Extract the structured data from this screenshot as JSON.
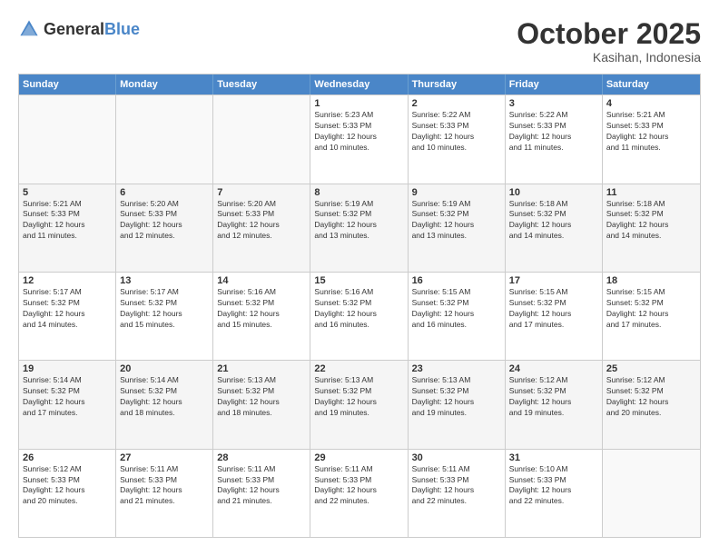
{
  "header": {
    "logo_general": "General",
    "logo_blue": "Blue",
    "month": "October 2025",
    "location": "Kasihan, Indonesia"
  },
  "days_of_week": [
    "Sunday",
    "Monday",
    "Tuesday",
    "Wednesday",
    "Thursday",
    "Friday",
    "Saturday"
  ],
  "weeks": [
    [
      {
        "num": "",
        "info": ""
      },
      {
        "num": "",
        "info": ""
      },
      {
        "num": "",
        "info": ""
      },
      {
        "num": "1",
        "info": "Sunrise: 5:23 AM\nSunset: 5:33 PM\nDaylight: 12 hours\nand 10 minutes."
      },
      {
        "num": "2",
        "info": "Sunrise: 5:22 AM\nSunset: 5:33 PM\nDaylight: 12 hours\nand 10 minutes."
      },
      {
        "num": "3",
        "info": "Sunrise: 5:22 AM\nSunset: 5:33 PM\nDaylight: 12 hours\nand 11 minutes."
      },
      {
        "num": "4",
        "info": "Sunrise: 5:21 AM\nSunset: 5:33 PM\nDaylight: 12 hours\nand 11 minutes."
      }
    ],
    [
      {
        "num": "5",
        "info": "Sunrise: 5:21 AM\nSunset: 5:33 PM\nDaylight: 12 hours\nand 11 minutes."
      },
      {
        "num": "6",
        "info": "Sunrise: 5:20 AM\nSunset: 5:33 PM\nDaylight: 12 hours\nand 12 minutes."
      },
      {
        "num": "7",
        "info": "Sunrise: 5:20 AM\nSunset: 5:33 PM\nDaylight: 12 hours\nand 12 minutes."
      },
      {
        "num": "8",
        "info": "Sunrise: 5:19 AM\nSunset: 5:32 PM\nDaylight: 12 hours\nand 13 minutes."
      },
      {
        "num": "9",
        "info": "Sunrise: 5:19 AM\nSunset: 5:32 PM\nDaylight: 12 hours\nand 13 minutes."
      },
      {
        "num": "10",
        "info": "Sunrise: 5:18 AM\nSunset: 5:32 PM\nDaylight: 12 hours\nand 14 minutes."
      },
      {
        "num": "11",
        "info": "Sunrise: 5:18 AM\nSunset: 5:32 PM\nDaylight: 12 hours\nand 14 minutes."
      }
    ],
    [
      {
        "num": "12",
        "info": "Sunrise: 5:17 AM\nSunset: 5:32 PM\nDaylight: 12 hours\nand 14 minutes."
      },
      {
        "num": "13",
        "info": "Sunrise: 5:17 AM\nSunset: 5:32 PM\nDaylight: 12 hours\nand 15 minutes."
      },
      {
        "num": "14",
        "info": "Sunrise: 5:16 AM\nSunset: 5:32 PM\nDaylight: 12 hours\nand 15 minutes."
      },
      {
        "num": "15",
        "info": "Sunrise: 5:16 AM\nSunset: 5:32 PM\nDaylight: 12 hours\nand 16 minutes."
      },
      {
        "num": "16",
        "info": "Sunrise: 5:15 AM\nSunset: 5:32 PM\nDaylight: 12 hours\nand 16 minutes."
      },
      {
        "num": "17",
        "info": "Sunrise: 5:15 AM\nSunset: 5:32 PM\nDaylight: 12 hours\nand 17 minutes."
      },
      {
        "num": "18",
        "info": "Sunrise: 5:15 AM\nSunset: 5:32 PM\nDaylight: 12 hours\nand 17 minutes."
      }
    ],
    [
      {
        "num": "19",
        "info": "Sunrise: 5:14 AM\nSunset: 5:32 PM\nDaylight: 12 hours\nand 17 minutes."
      },
      {
        "num": "20",
        "info": "Sunrise: 5:14 AM\nSunset: 5:32 PM\nDaylight: 12 hours\nand 18 minutes."
      },
      {
        "num": "21",
        "info": "Sunrise: 5:13 AM\nSunset: 5:32 PM\nDaylight: 12 hours\nand 18 minutes."
      },
      {
        "num": "22",
        "info": "Sunrise: 5:13 AM\nSunset: 5:32 PM\nDaylight: 12 hours\nand 19 minutes."
      },
      {
        "num": "23",
        "info": "Sunrise: 5:13 AM\nSunset: 5:32 PM\nDaylight: 12 hours\nand 19 minutes."
      },
      {
        "num": "24",
        "info": "Sunrise: 5:12 AM\nSunset: 5:32 PM\nDaylight: 12 hours\nand 19 minutes."
      },
      {
        "num": "25",
        "info": "Sunrise: 5:12 AM\nSunset: 5:32 PM\nDaylight: 12 hours\nand 20 minutes."
      }
    ],
    [
      {
        "num": "26",
        "info": "Sunrise: 5:12 AM\nSunset: 5:33 PM\nDaylight: 12 hours\nand 20 minutes."
      },
      {
        "num": "27",
        "info": "Sunrise: 5:11 AM\nSunset: 5:33 PM\nDaylight: 12 hours\nand 21 minutes."
      },
      {
        "num": "28",
        "info": "Sunrise: 5:11 AM\nSunset: 5:33 PM\nDaylight: 12 hours\nand 21 minutes."
      },
      {
        "num": "29",
        "info": "Sunrise: 5:11 AM\nSunset: 5:33 PM\nDaylight: 12 hours\nand 22 minutes."
      },
      {
        "num": "30",
        "info": "Sunrise: 5:11 AM\nSunset: 5:33 PM\nDaylight: 12 hours\nand 22 minutes."
      },
      {
        "num": "31",
        "info": "Sunrise: 5:10 AM\nSunset: 5:33 PM\nDaylight: 12 hours\nand 22 minutes."
      },
      {
        "num": "",
        "info": ""
      }
    ]
  ]
}
